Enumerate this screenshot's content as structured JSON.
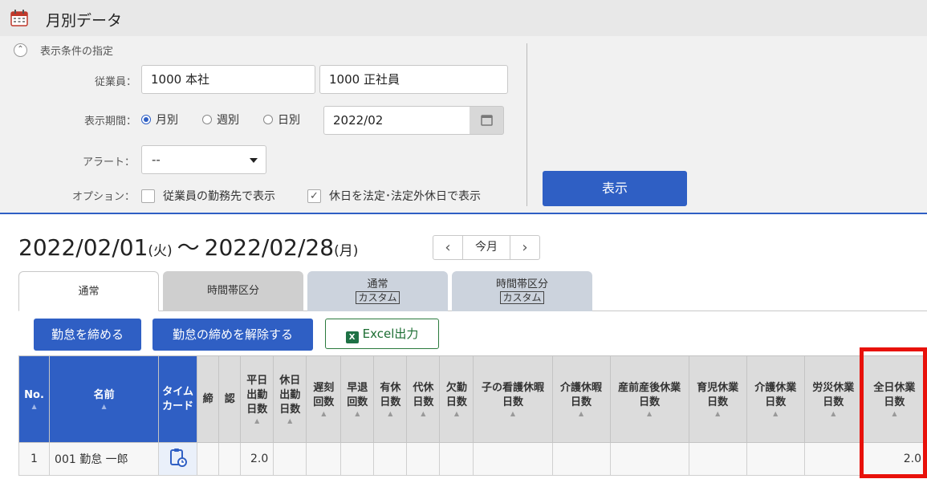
{
  "app": {
    "title": "月別データ"
  },
  "filter": {
    "heading": "表示条件の指定",
    "employee_label": "従業員：",
    "employee_value1": "1000 本社",
    "employee_value2": "1000 正社員",
    "period_label": "表示期間：",
    "period_options": [
      "月別",
      "週別",
      "日別"
    ],
    "period_selected": "月別",
    "period_value": "2022/02",
    "alert_label": "アラート：",
    "alert_value": "--",
    "option_label": "オプション：",
    "option1": {
      "label": "従業員の勤務先で表示",
      "checked": false
    },
    "option2": {
      "label": "休日を法定･法定外休日で表示",
      "checked": true
    },
    "show_button": "表示"
  },
  "range": {
    "start": "2022/02/01",
    "start_dow": "(火)",
    "sep": "〜",
    "end": "2022/02/28",
    "end_dow": "(月)"
  },
  "pager": {
    "prev": "‹",
    "current": "今月",
    "next": "›"
  },
  "tabs": [
    {
      "line1": "通常",
      "line2": ""
    },
    {
      "line1": "時間帯区分",
      "line2": ""
    },
    {
      "line1": "通常",
      "line2": "カスタム"
    },
    {
      "line1": "時間帯区分",
      "line2": "カスタム"
    }
  ],
  "actions": {
    "close": "勤怠を締める",
    "unclose": "勤怠の締めを解除する",
    "excel": "Excel出力",
    "excel_icon": "X"
  },
  "table": {
    "headers": [
      "No.",
      "名前",
      "タイム カード",
      "締",
      "認",
      "平日 出勤 日数",
      "休日 出勤 日数",
      "遅刻 回数",
      "早退 回数",
      "有休 日数",
      "代休 日数",
      "欠勤 日数",
      "子の看護休暇 日数",
      "介護休暇 日数",
      "産前産後休業 日数",
      "育児休業 日数",
      "介護休業 日数",
      "労災休業 日数",
      "全日休業 日数"
    ],
    "rows": [
      {
        "no": "1",
        "name": "001 勤怠 一郎",
        "weekday_days": "2.0",
        "full_leave_days": "2.0"
      }
    ]
  },
  "colors": {
    "accent": "#2f5fc4",
    "highlight": "#e8110a",
    "excel_green": "#1e7145"
  }
}
